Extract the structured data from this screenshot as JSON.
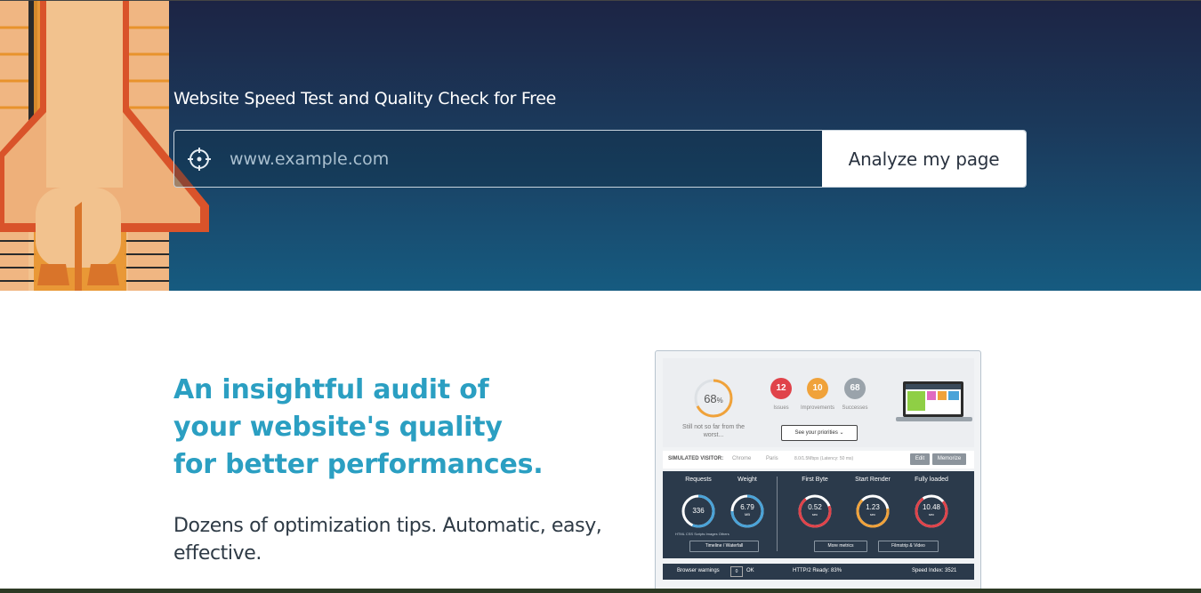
{
  "hero": {
    "title": "Website Speed Test and Quality Check for Free",
    "search_placeholder": "www.example.com",
    "search_value": "",
    "analyze_label": "Analyze my page"
  },
  "intro": {
    "headline_lines": [
      "An insightful audit of",
      "your website's quality",
      "for better performances."
    ],
    "subtext": "Dozens of optimization tips. Automatic, easy, effective."
  },
  "preview": {
    "score": "68",
    "score_unit": "%",
    "score_caption": "Still not so far from the worst...",
    "issues_count": "12",
    "issues_label": "Issues",
    "improvements_count": "10",
    "improvements_label": "Improvements",
    "successes_count": "68",
    "successes_label": "Successes",
    "priorities_label": "See your priorities ⌄",
    "sim_label": "SIMULATED VISITOR:",
    "sim_browser": "Chrome",
    "sim_city": "Paris",
    "sim_speed": "8.0/1.5Mbps (Latency: 50 ms)",
    "edit_label": "Edit",
    "memorize_label": "Memorize",
    "requests_title": "Requests",
    "requests_value": "336",
    "weight_title": "Weight",
    "weight_value": "6.79",
    "weight_unit": "MB",
    "first_byte_title": "First Byte",
    "first_byte_value": "0.52",
    "start_render_title": "Start Render",
    "start_render_value": "1.23",
    "fully_loaded_title": "Fully loaded",
    "fully_loaded_value": "10.48",
    "seconds_unit": "sec",
    "legend": "HTML  CSS  Scripts  Images  Others",
    "timeline_label": "Timeline / Waterfall",
    "more_metrics_label": "More metrics",
    "filmstrip_label": "Filmstrip & Video",
    "browser_warnings_label": "Browser warnings",
    "browser_warnings_count": "0",
    "ok_label": "OK",
    "http2_label": "HTTP/2 Ready: 83%",
    "speed_index_label": "Speed Index: 3521"
  },
  "colors": {
    "accent": "#2b9fc2",
    "issues": "#e0434a",
    "improvements": "#f0a23a",
    "successes": "#9aa3ab"
  }
}
